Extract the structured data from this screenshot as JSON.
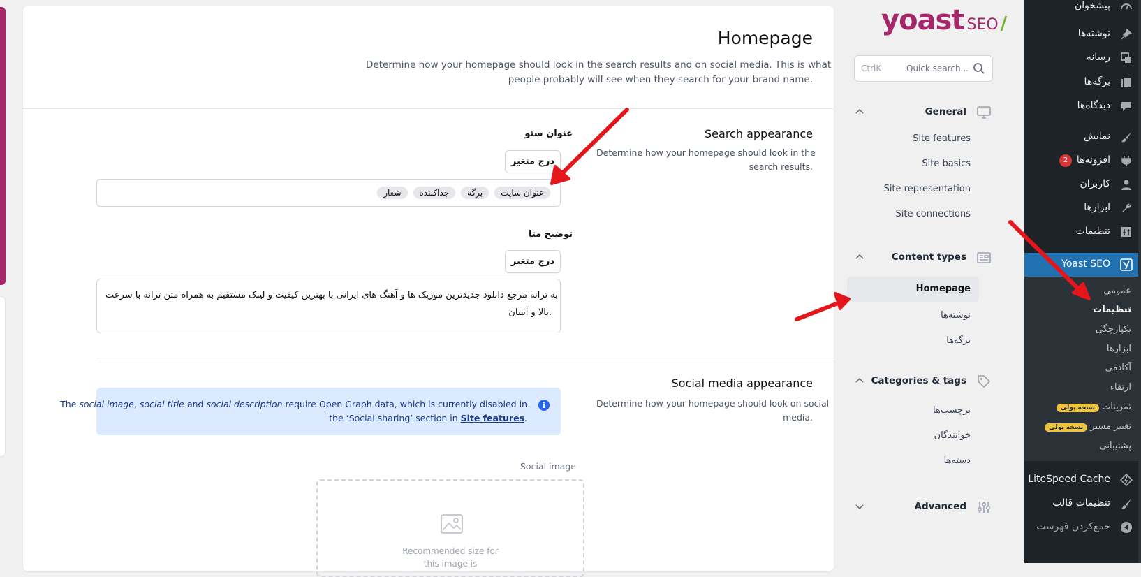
{
  "main": {
    "title": "Homepage",
    "desc_line1": "Determine how your homepage should look in the search results and on social media. This is what",
    "desc_line2": "people probably will see when they search for your brand name.",
    "search_appearance": {
      "title": "Search appearance",
      "desc_line1": "Determine how your homepage should look in the",
      "desc_line2": "search results."
    },
    "seo_title_label": "عنوان سئو",
    "insert_variable_label": "درج متغیر",
    "seo_title_tags": [
      "عنوان سایت",
      "برگه",
      "جداکننده",
      "شعار"
    ],
    "meta_desc_label": "توضیح متا",
    "meta_desc_line1": "به ترانه مرجع دانلود جدیدترین موزیک ها و آهنگ های ایرانی با بهترین کیفیت و لینک مستقیم به همراه متن ترانه با سرعت",
    "meta_desc_line2": "بالا و آسان.",
    "social_appearance": {
      "title": "Social media appearance",
      "desc_line1": "Determine how your homepage should look on social",
      "desc_line2": "media."
    },
    "alert": {
      "p1": "The ",
      "e1": "social image",
      "p2": ", ",
      "e2": "social title",
      "p3": " and ",
      "e3": "social description",
      "p4": " require Open Graph data, which is currently disabled in",
      "p5": "the ‘Social sharing’ section in ",
      "link": "Site features",
      "p6": "."
    },
    "social_image_label": "Social image",
    "image_hint_line1": "Recommended size for",
    "image_hint_line2": "this image is"
  },
  "yoast_nav": {
    "logo_main": "yoast",
    "logo_seo": "SEO",
    "logo_slash": "/",
    "search_placeholder": "Quick search...",
    "search_shortcut": "CtrlK",
    "groups": [
      {
        "label": "General",
        "icon": "monitor-icon",
        "items": [
          "Site features",
          "Site basics",
          "Site representation",
          "Site connections"
        ]
      },
      {
        "label": "Content types",
        "icon": "newspaper-icon",
        "items": [
          "Homepage",
          "نوشته‌ها",
          "برگه‌ها"
        ]
      },
      {
        "label": "Categories & tags",
        "icon": "tag-icon",
        "items": [
          "برچسب‌ها",
          "خوانندگان",
          "دسته‌ها"
        ]
      },
      {
        "label": "Advanced",
        "icon": "sliders-icon",
        "items": []
      }
    ],
    "active_item": "Homepage"
  },
  "wp_menu": {
    "items": [
      {
        "label": "پیشخوان",
        "icon": "dashboard-icon"
      },
      {
        "label": "نوشته‌ها",
        "icon": "pin-icon"
      },
      {
        "label": "رسانه",
        "icon": "media-icon"
      },
      {
        "label": "برگه‌ها",
        "icon": "page-icon"
      },
      {
        "label": "دیدگاه‌ها",
        "icon": "comment-icon"
      },
      {
        "label": "نمایش",
        "icon": "brush-icon"
      },
      {
        "label": "افزونه‌ها",
        "icon": "plugin-icon",
        "badge": "2"
      },
      {
        "label": "کاربران",
        "icon": "user-icon"
      },
      {
        "label": "ابزارها",
        "icon": "wrench-icon"
      },
      {
        "label": "تنظیمات",
        "icon": "settings-icon"
      },
      {
        "label": "Yoast SEO",
        "icon": "yoast-icon"
      }
    ],
    "submenu": [
      {
        "label": "عمومی"
      },
      {
        "label": "تنظیمات"
      },
      {
        "label": "یکپارچگی"
      },
      {
        "label": "ابزارها"
      },
      {
        "label": "آکادمی"
      },
      {
        "label": "ارتقاء"
      },
      {
        "label": "تمرینات",
        "pill": "نسخه پولی"
      },
      {
        "label": "تغییر مسیر",
        "pill": "نسخه پولی"
      },
      {
        "label": "پشتیبانی"
      }
    ],
    "after": [
      {
        "label": "LiteSpeed Cache",
        "icon": "litespeed-icon"
      },
      {
        "label": "تنظیمات قالب",
        "icon": "brush-icon"
      },
      {
        "label": "جمع‌کردن فهرست",
        "icon": "collapse-icon"
      }
    ]
  },
  "colors": {
    "yoast_purple": "#a4286a",
    "wp_blue": "#2271b1",
    "annotation_red": "#e4161b"
  }
}
